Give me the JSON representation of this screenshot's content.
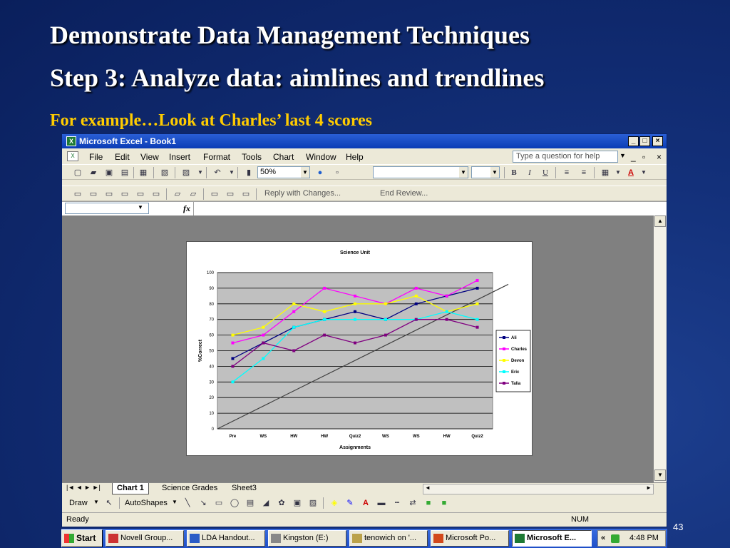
{
  "slide": {
    "title_line1": "Demonstrate Data Management Techniques",
    "title_line2": "Step 3: Analyze data: aimlines and trendlines",
    "subtitle": "For example…Look at Charles’ last 4 scores",
    "slide_number": "43"
  },
  "window": {
    "title": "Microsoft Excel - Book1",
    "minimize": "_",
    "restore": "□",
    "close": "×"
  },
  "menu": {
    "items": [
      "File",
      "Edit",
      "View",
      "Insert",
      "Format",
      "Tools",
      "Chart",
      "Window",
      "Help"
    ],
    "ask_placeholder": "Type a question for help"
  },
  "toolbar": {
    "zoom": "50%",
    "reply_label": "Reply with Changes...",
    "end_review_label": "End Review...",
    "bold": "B",
    "italic": "I",
    "underline": "U",
    "font_color": "A"
  },
  "formula_bar": {
    "fx": "fx"
  },
  "sheet_tabs": {
    "nav": "|◄ ◄ ► ►|",
    "tabs": [
      "Chart 1",
      "Science Grades",
      "Sheet3"
    ]
  },
  "drawing_toolbar": {
    "draw": "Draw",
    "autoshapes": "AutoShapes"
  },
  "status": {
    "ready": "Ready",
    "num": "NUM"
  },
  "taskbar": {
    "start": "Start",
    "tasks": [
      "Novell Group...",
      "LDA Handout...",
      "Kingston (E:)",
      "tenowich on '...",
      "Microsoft Po...",
      "Microsoft E..."
    ],
    "time": "4:48 PM"
  },
  "chart_data": {
    "type": "line",
    "title": "Science Unit",
    "xlabel": "Assignments",
    "ylabel": "%Correct",
    "categories": [
      "Pre",
      "WS",
      "HW",
      "HW",
      "Quiz2",
      "WS",
      "WS",
      "HW",
      "Quiz2"
    ],
    "ylim": [
      0,
      100
    ],
    "yticks": [
      0,
      10,
      20,
      30,
      40,
      50,
      60,
      70,
      80,
      90,
      100
    ],
    "grid": true,
    "legend": "right",
    "series": [
      {
        "name": "Ali",
        "color": "#000080",
        "values": [
          45,
          55,
          65,
          70,
          75,
          70,
          80,
          85,
          90
        ]
      },
      {
        "name": "Charles",
        "color": "#ff00ff",
        "values": [
          55,
          60,
          75,
          90,
          85,
          80,
          90,
          85,
          95
        ]
      },
      {
        "name": "Devon",
        "color": "#ffff00",
        "values": [
          60,
          65,
          80,
          75,
          80,
          80,
          85,
          75,
          80
        ]
      },
      {
        "name": "Eric",
        "color": "#00ffff",
        "values": [
          30,
          45,
          65,
          70,
          70,
          70,
          70,
          75,
          70
        ]
      },
      {
        "name": "Talia",
        "color": "#800080",
        "values": [
          40,
          55,
          50,
          60,
          55,
          60,
          70,
          70,
          65
        ]
      }
    ],
    "aimline": {
      "from": [
        0,
        0
      ],
      "to": [
        8,
        90
      ],
      "color": "#404040"
    }
  }
}
